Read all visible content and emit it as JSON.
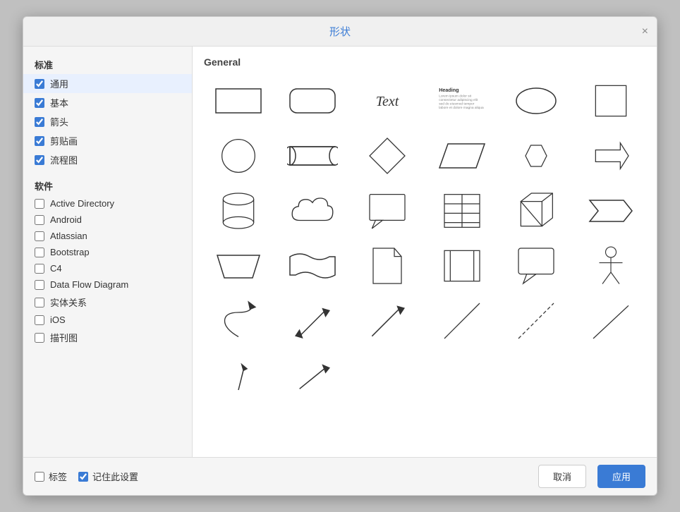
{
  "dialog": {
    "title": "形状",
    "close_label": "×"
  },
  "sidebar": {
    "standard_section": "标准",
    "software_section": "软件",
    "standard_items": [
      {
        "label": "通用",
        "checked": true,
        "selected": true
      },
      {
        "label": "基本",
        "checked": true,
        "selected": false
      },
      {
        "label": "箭头",
        "checked": true,
        "selected": false
      },
      {
        "label": "剪贴画",
        "checked": true,
        "selected": false
      },
      {
        "label": "流程图",
        "checked": true,
        "selected": false
      }
    ],
    "software_items": [
      {
        "label": "Active Directory",
        "checked": false
      },
      {
        "label": "Android",
        "checked": false
      },
      {
        "label": "Atlassian",
        "checked": false
      },
      {
        "label": "Bootstrap",
        "checked": false
      },
      {
        "label": "C4",
        "checked": false
      },
      {
        "label": "Data Flow Diagram",
        "checked": false
      },
      {
        "label": "实体关系",
        "checked": false
      },
      {
        "label": "iOS",
        "checked": false
      },
      {
        "label": "描刊图",
        "checked": false
      }
    ]
  },
  "main": {
    "section_title": "General"
  },
  "footer": {
    "tag_label": "标签",
    "remember_label": "记住此设置",
    "cancel_label": "取消",
    "apply_label": "应用",
    "tag_checked": false,
    "remember_checked": true
  }
}
